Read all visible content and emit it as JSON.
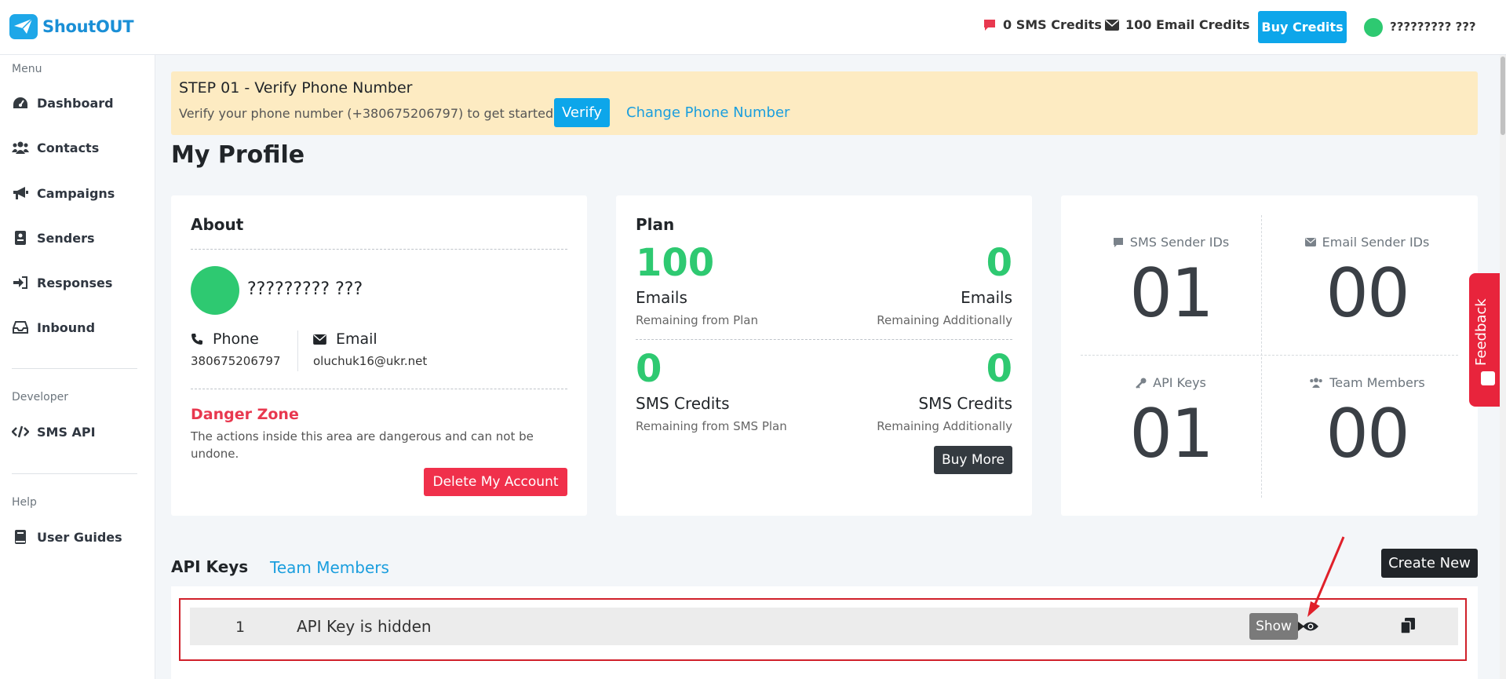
{
  "header": {
    "logo_text": "ShoutOUT",
    "sms_credits": "0 SMS Credits",
    "email_credits": "100 Email Credits",
    "buy_credits_label": "Buy Credits",
    "user_name": "????????? ???"
  },
  "sidebar": {
    "menu_label": "Menu",
    "items": [
      {
        "label": "Dashboard"
      },
      {
        "label": "Contacts"
      },
      {
        "label": "Campaigns"
      },
      {
        "label": "Senders"
      },
      {
        "label": "Responses"
      },
      {
        "label": "Inbound"
      }
    ],
    "developer_label": "Developer",
    "developer_items": [
      {
        "label": "SMS API"
      }
    ],
    "help_label": "Help",
    "help_items": [
      {
        "label": "User Guides"
      }
    ]
  },
  "banner": {
    "title": "STEP 01 - Verify Phone Number",
    "text": "Verify your phone number (+380675206797) to get started.",
    "verify_label": "Verify",
    "change_label": "Change Phone Number"
  },
  "page_title": "My Profile",
  "about": {
    "title": "About",
    "name": "????????? ???",
    "phone_label": "Phone",
    "phone_value": "380675206797",
    "email_label": "Email",
    "email_value": "oluchuk16@ukr.net",
    "danger_title": "Danger Zone",
    "danger_text": "The actions inside this area are dangerous and can not be undone.",
    "delete_label": "Delete My Account"
  },
  "plan": {
    "title": "Plan",
    "email_plan_value": "100",
    "email_plan_unit": "Emails",
    "email_plan_sub": "Remaining from Plan",
    "email_add_value": "0",
    "email_add_unit": "Emails",
    "email_add_sub": "Remaining Additionally",
    "sms_plan_value": "0",
    "sms_plan_unit": "SMS Credits",
    "sms_plan_sub": "Remaining from SMS Plan",
    "sms_add_value": "0",
    "sms_add_unit": "SMS Credits",
    "sms_add_sub": "Remaining Additionally",
    "buy_more_label": "Buy More"
  },
  "stats": {
    "sms_sender_label": "SMS Sender IDs",
    "sms_sender_value": "01",
    "email_sender_label": "Email Sender IDs",
    "email_sender_value": "00",
    "api_keys_label": "API Keys",
    "api_keys_value": "01",
    "team_members_label": "Team Members",
    "team_members_value": "00"
  },
  "tabs": {
    "api_keys": "API Keys",
    "team_members": "Team Members",
    "create_new_label": "Create New"
  },
  "api_table": {
    "rows": [
      {
        "num": "1",
        "text": "API Key is hidden"
      }
    ],
    "tooltip": "Show"
  },
  "feedback_label": "Feedback",
  "colors": {
    "accent": "#0da6ea",
    "success": "#2ec971",
    "danger": "#f0304b",
    "banner": "#fdebc2"
  }
}
